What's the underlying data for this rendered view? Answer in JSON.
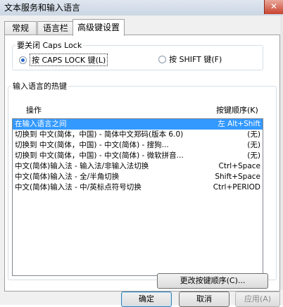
{
  "window": {
    "title": "文本服务和输入语言",
    "close_label": "✕"
  },
  "tabs": [
    {
      "label": "常规"
    },
    {
      "label": "语言栏"
    },
    {
      "label": "高级键设置"
    }
  ],
  "caps_lock": {
    "legend": "要关闭 Caps Lock",
    "option1": "按 CAPS LOCK 键(L)",
    "option2": "按 SHIFT 键(F)",
    "selected": "option1"
  },
  "hotkeys": {
    "legend": "输入语言的热键",
    "col_action": "操作",
    "col_sequence": "按键顺序(K)",
    "rows": [
      {
        "action": "在输入语言之间",
        "key": "左 Alt+Shift",
        "selected": true
      },
      {
        "action": "切换到 中文(简体，中国) - 简体中文郑码(版本 6.0)",
        "key": "(无)"
      },
      {
        "action": "切换到 中文(简体，中国) - 中文(简体) - 搜狗...",
        "key": "(无)"
      },
      {
        "action": "切换到 中文(简体，中国) - 中文(简体) - 微软拼音...",
        "key": "(无)"
      },
      {
        "action": "中文(简体)输入法 - 输入法/非输入法切换",
        "key": "Ctrl+Space"
      },
      {
        "action": "中文(简体)输入法 - 全/半角切换",
        "key": "Shift+Space"
      },
      {
        "action": "中文(简体)输入法 - 中/英标点符号切换",
        "key": "Ctrl+PERIOD"
      }
    ],
    "change_button": "更改按键顺序(C)..."
  },
  "footer": {
    "ok": "确定",
    "cancel": "取消",
    "apply": "应用(A)"
  }
}
